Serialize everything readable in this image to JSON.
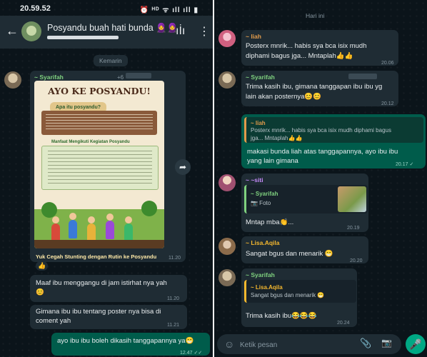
{
  "left": {
    "status": {
      "time": "20.59.52",
      "icons": "⏰ ᴴᴰ ᯤ ıll ıll ▮"
    },
    "header": {
      "title": "Posyandu buah hati bunda 🧕🧕"
    },
    "date_chip": "Kemarin",
    "poster_msg": {
      "sender": "~ Syarifah",
      "phone": "+6",
      "poster_title": "AYO KE POSYANDU!",
      "poster_sub1": "Apa itu posyandu?",
      "poster_sub2": "Manfaat Mengikuti Kegiatan Posyandu",
      "caption": "Yuk Cegah Stunting dengan Rutin ke Posyandu",
      "time": "11.20",
      "reaction": "👍"
    },
    "msg1": {
      "text1": "Maaf ibu menggangu di jam istirhat nya yah",
      "text2": "😊",
      "time": "11.20"
    },
    "msg2": {
      "text1": "Gimana ibu ibu tentang poster nya bisa di",
      "text2": "coment yah",
      "time": "11.21"
    },
    "msg3": {
      "text": "ayo ibu ibu boleh dikasih tanggapannya ya😁",
      "time": "12.47 ✓✓"
    },
    "footer": {
      "placeholder": "Ketik pesan",
      "emoji": "☺",
      "clip": "📎",
      "cam": "📷",
      "mic": "🎤"
    }
  },
  "right": {
    "date_chip": "Hari ini",
    "m1": {
      "sender": "~ liah",
      "text1": "Posterx mnrik... habis sya bca isix mudh",
      "text2": "diphami bagus jga... Mntaplah👍👍",
      "time": "20.06"
    },
    "m2": {
      "sender": "~ Syarifah",
      "text1": "Trima kasih ibu, gimana tanggapan ibu ibu yg",
      "text2": "lain akan posternya😊😊",
      "time": "20.12"
    },
    "m3": {
      "quote_sender": "~ liah",
      "quote_text1": "Posterx mnrik... habis sya bca isix mudh diphami bagus",
      "quote_text2": "jga... Mntaplah👍👍",
      "text1": "makasi bunda liah atas tanggapannya, ayo ibu ibu",
      "text2": "yang lain gimana",
      "time": "20.17 ✓"
    },
    "m4": {
      "sender": "~ ~siti",
      "quote_sender": "~ Syarifah",
      "quote_text": "📷 Foto",
      "text": "Mntap mba👏...",
      "time": "20.19"
    },
    "m5": {
      "sender": "~ Lisa.Aqila",
      "text": "Sangat bgus dan menarik 😁",
      "time": "20.20"
    },
    "m6": {
      "sender": "~ Syarifah",
      "quote_sender": "~ Lisa.Aqila",
      "quote_text": "Sangat bgus dan menarik 😁",
      "text": "Trima kasih ibu😂😂😂",
      "time": "20.24"
    }
  }
}
